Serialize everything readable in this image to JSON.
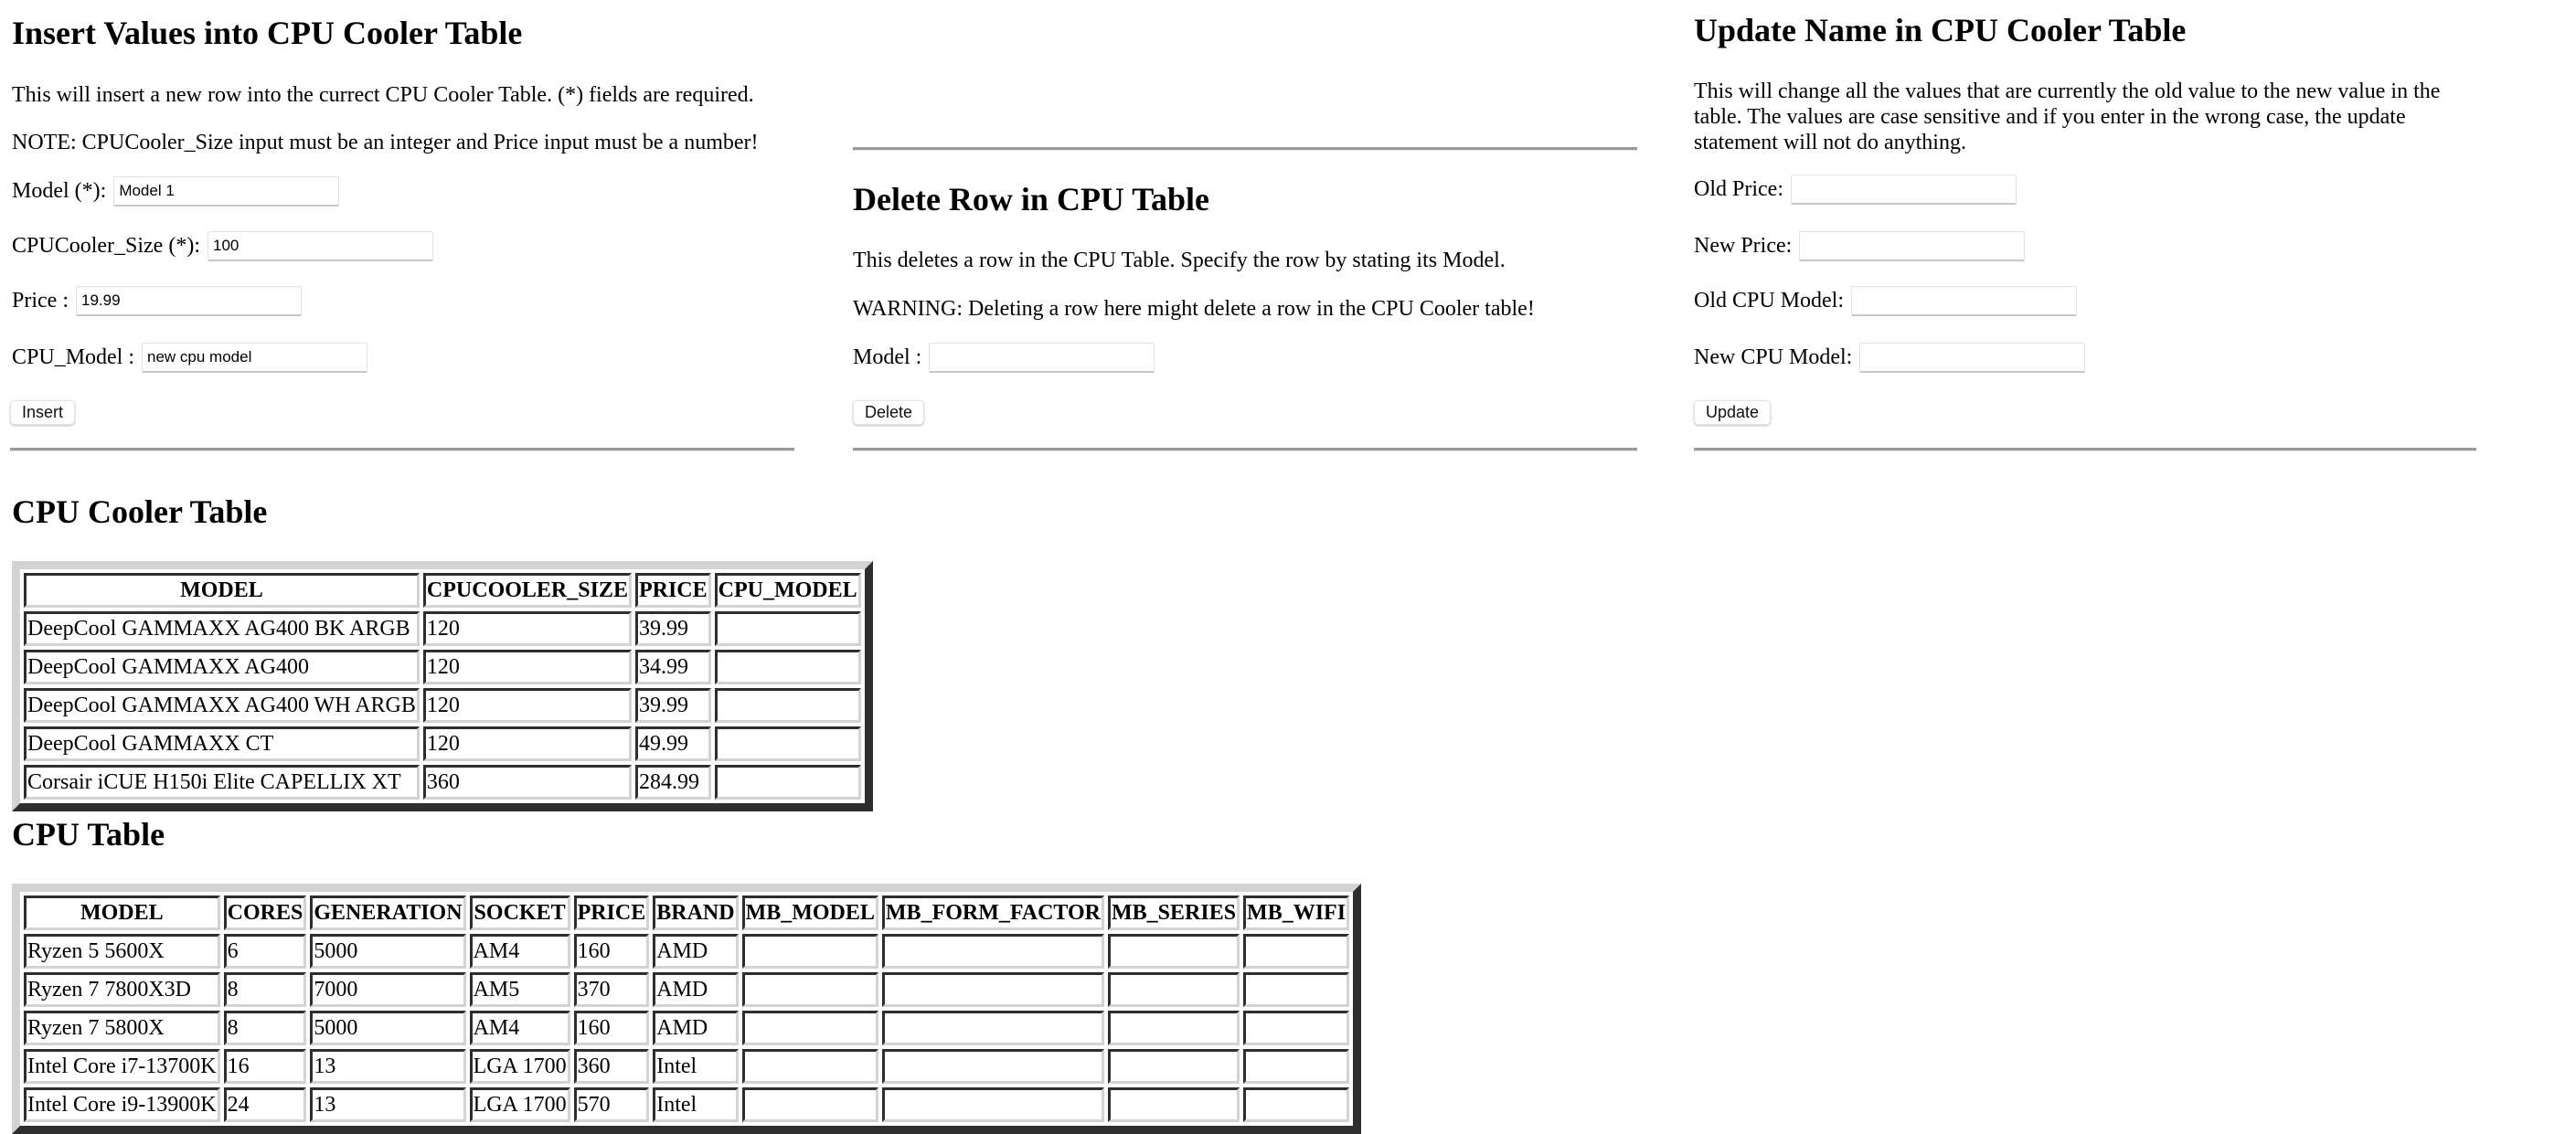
{
  "insert": {
    "title": "Insert Values into CPU Cooler Table",
    "description": "This will insert a new row into the currect CPU Cooler Table. (*) fields are required.",
    "note": "NOTE: CPUCooler_Size input must be an integer and Price input must be a number!",
    "fields": [
      {
        "label": "Model (*):",
        "value": "Model 1"
      },
      {
        "label": "CPUCooler_Size (*):",
        "value": "100"
      },
      {
        "label": "Price :",
        "value": "19.99"
      },
      {
        "label": "CPU_Model :",
        "value": "new cpu model"
      }
    ],
    "button": "Insert"
  },
  "delete": {
    "title": "Delete Row in CPU Table",
    "description": "This deletes a row in the CPU Table. Specify the row by stating its Model.",
    "warning": "WARNING: Deleting a row here might delete a row in the CPU Cooler table!",
    "fields": [
      {
        "label": "Model :",
        "value": ""
      }
    ],
    "button": "Delete"
  },
  "update": {
    "title": "Update Name in CPU Cooler Table",
    "description": "This will change all the values that are currently the old value to the new value in the table. The values are case sensitive and if you enter in the wrong case, the update statement will not do anything.",
    "fields": [
      {
        "label": "Old Price:",
        "value": ""
      },
      {
        "label": "New Price:",
        "value": ""
      },
      {
        "label": "Old CPU Model:",
        "value": ""
      },
      {
        "label": "New CPU Model:",
        "value": ""
      }
    ],
    "button": "Update"
  },
  "cooler_table": {
    "title": "CPU Cooler Table",
    "columns": [
      "MODEL",
      "CPUCOOLER_SIZE",
      "PRICE",
      "CPU_MODEL"
    ],
    "rows": [
      [
        "DeepCool GAMMAXX AG400 BK ARGB",
        "120",
        "39.99",
        ""
      ],
      [
        "DeepCool GAMMAXX AG400",
        "120",
        "34.99",
        ""
      ],
      [
        "DeepCool GAMMAXX AG400 WH ARGB",
        "120",
        "39.99",
        ""
      ],
      [
        "DeepCool GAMMAXX CT",
        "120",
        "49.99",
        ""
      ],
      [
        "Corsair iCUE H150i Elite CAPELLIX XT",
        "360",
        "284.99",
        ""
      ]
    ]
  },
  "cpu_table": {
    "title": "CPU Table",
    "columns": [
      "MODEL",
      "CORES",
      "GENERATION",
      "SOCKET",
      "PRICE",
      "BRAND",
      "MB_MODEL",
      "MB_FORM_FACTOR",
      "MB_SERIES",
      "MB_WIFI"
    ],
    "rows": [
      [
        "Ryzen 5 5600X",
        "6",
        "5000",
        "AM4",
        "160",
        "AMD",
        "",
        "",
        "",
        ""
      ],
      [
        "Ryzen 7 7800X3D",
        "8",
        "7000",
        "AM5",
        "370",
        "AMD",
        "",
        "",
        "",
        ""
      ],
      [
        "Ryzen 7 5800X",
        "8",
        "5000",
        "AM4",
        "160",
        "AMD",
        "",
        "",
        "",
        ""
      ],
      [
        "Intel Core i7-13700K",
        "16",
        "13",
        "LGA 1700",
        "360",
        "Intel",
        "",
        "",
        "",
        ""
      ],
      [
        "Intel Core i9-13900K",
        "24",
        "13",
        "LGA 1700",
        "570",
        "Intel",
        "",
        "",
        "",
        ""
      ]
    ]
  }
}
